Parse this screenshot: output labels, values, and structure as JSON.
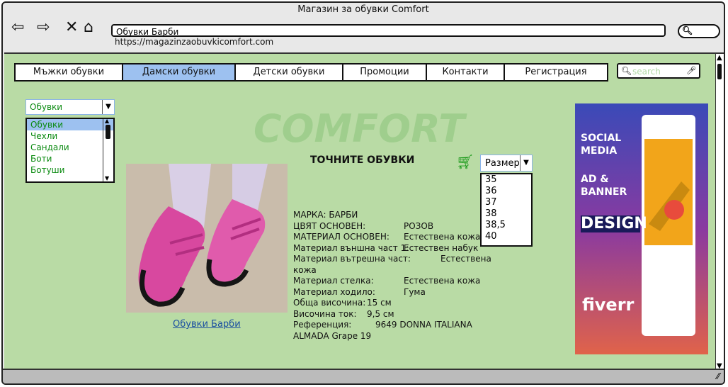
{
  "window": {
    "title": "Магазин за обувки Comfort"
  },
  "browser": {
    "address": "Обувки Барби",
    "url": "https://magazinzaobuvkicomfort.com"
  },
  "nav": {
    "items": [
      {
        "label": "Мъжки обувки"
      },
      {
        "label": "Дамски обувки"
      },
      {
        "label": "Детски обувки"
      },
      {
        "label": "Промоции"
      },
      {
        "label": "Контакти"
      },
      {
        "label": "Регистрация"
      }
    ]
  },
  "search": {
    "placeholder": "search"
  },
  "category": {
    "selected": "Обувки",
    "options": [
      "Обувки",
      "Чехли",
      "Сандали",
      "Боти",
      "Ботуши"
    ]
  },
  "logo": "COMFORT",
  "product": {
    "heading": "ТОЧНИТЕ ОБУВКИ",
    "image_caption": "Обувки Барби",
    "details": [
      {
        "label": "МАРКА:",
        "value": "БАРБИ"
      },
      {
        "label": "ЦВЯТ ОСНОВЕН:",
        "value": "РОЗОВ"
      },
      {
        "label": "МАТЕРИАЛ ОСНОВЕН:",
        "value": "Естествена кожа"
      },
      {
        "label": "Материал външна част 1:",
        "value": "Естествен набук"
      },
      {
        "label": "Материал вътрешна част:",
        "value": "Естествена"
      },
      {
        "label": "кожа",
        "value": ""
      },
      {
        "label": "Материал стелка:",
        "value": "Естествена кожа"
      },
      {
        "label": "Материал ходило:",
        "value": "Гума"
      },
      {
        "label": "Обща височина:",
        "value": "15 см"
      },
      {
        "label": "Височина ток:",
        "value": "9,5 см"
      },
      {
        "label": "Референция:",
        "value": "9649 DONNA ITALIANA"
      },
      {
        "label": "ALMADA Grape 19",
        "value": ""
      }
    ]
  },
  "size": {
    "label": "Размер",
    "options": [
      "35",
      "36",
      "37",
      "38",
      "38,5",
      "40"
    ]
  },
  "ad": {
    "lines": [
      "SOCIAL MEDIA",
      "AD & BANNER",
      "DESIGN"
    ],
    "footer": "fiverr"
  },
  "icons": [
    "back-icon",
    "forward-icon",
    "close-icon",
    "home-icon",
    "search-icon",
    "mic-icon",
    "cart-add-icon",
    "chevron-down-icon"
  ]
}
